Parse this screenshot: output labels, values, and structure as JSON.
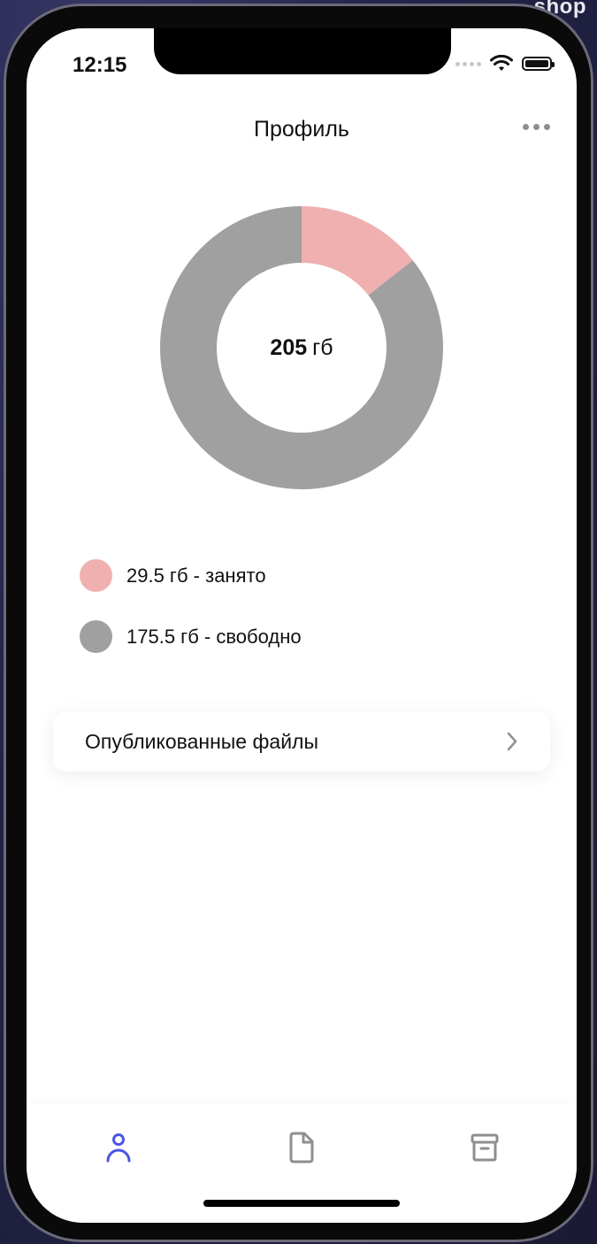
{
  "background_label": "shop",
  "status_bar": {
    "time": "12:15"
  },
  "header": {
    "title": "Профиль"
  },
  "storage": {
    "total_value": "205",
    "total_unit": "гб"
  },
  "chart_data": {
    "type": "pie",
    "categories": [
      "занято",
      "свободно"
    ],
    "values": [
      29.5,
      175.5
    ],
    "colors": [
      "#f0b0b0",
      "#a0a0a0"
    ]
  },
  "legend": [
    {
      "label": "29.5 гб - занято",
      "color": "#f0b0b0"
    },
    {
      "label": "175.5 гб - свободно",
      "color": "#a0a0a0"
    }
  ],
  "menu": {
    "published_files_label": "Опубликованные файлы"
  },
  "tabs": [
    {
      "icon": "person-icon",
      "active": true
    },
    {
      "icon": "file-icon",
      "active": false
    },
    {
      "icon": "archive-icon",
      "active": false
    }
  ],
  "colors": {
    "accent": "#4a55e6",
    "inactive": "#8e8e93"
  }
}
